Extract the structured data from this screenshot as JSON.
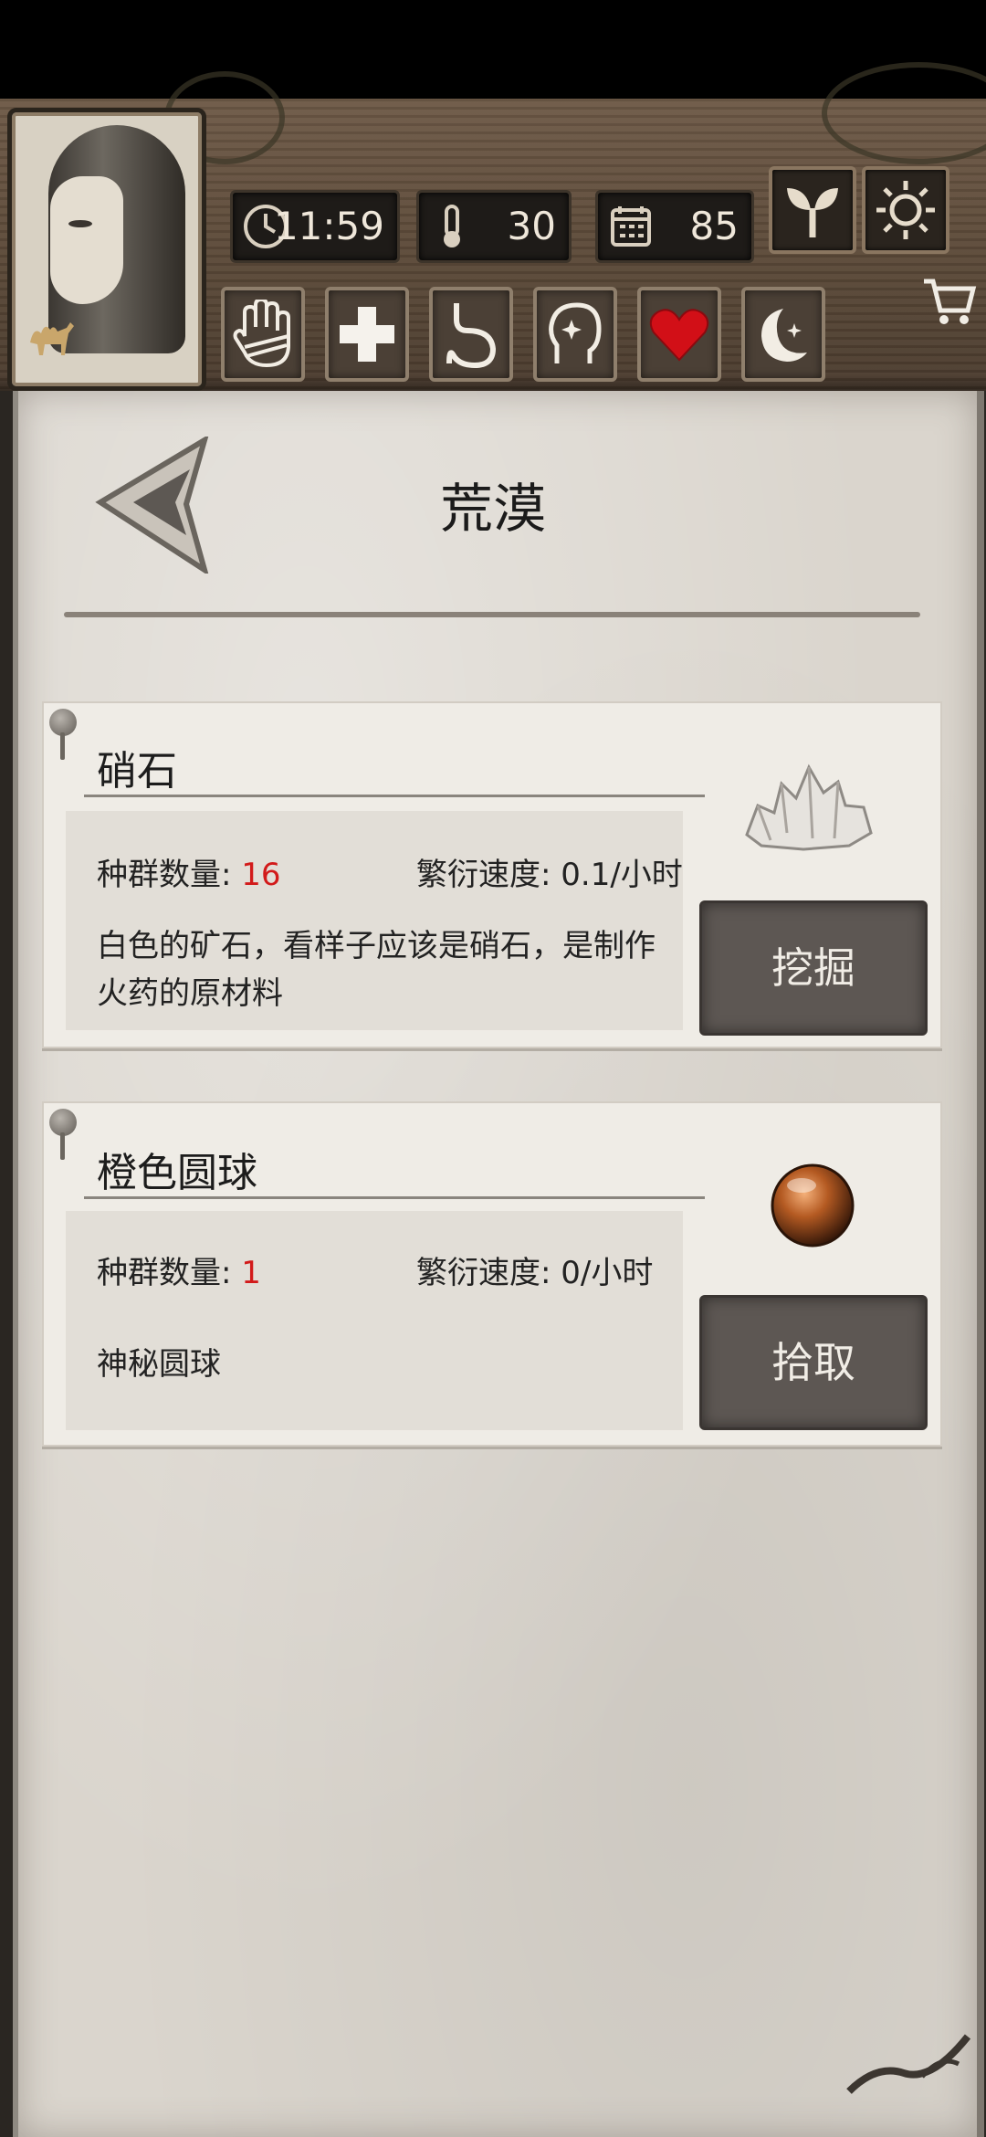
{
  "hud": {
    "time": "11:59",
    "temperature": "30",
    "day": "85"
  },
  "location": {
    "title": "荒漠"
  },
  "resources": [
    {
      "name": "硝石",
      "population_label": "种群数量:",
      "population": "16",
      "rate_label": "繁衍速度:",
      "rate": "0.1/小时",
      "description": "白色的矿石，看样子应该是硝石，是制作火药的原材料",
      "action": "挖掘",
      "icon": "saltpeter-crystal-icon"
    },
    {
      "name": "橙色圆球",
      "population_label": "种群数量:",
      "population": "1",
      "rate_label": "繁衍速度:",
      "rate": "0/小时",
      "description": "神秘圆球",
      "action": "拾取",
      "icon": "orange-orb-icon"
    }
  ],
  "colors": {
    "panel": "#dad5cd",
    "card": "#efece6",
    "button": "#5d5753",
    "highlight_red": "#d21a1a"
  }
}
